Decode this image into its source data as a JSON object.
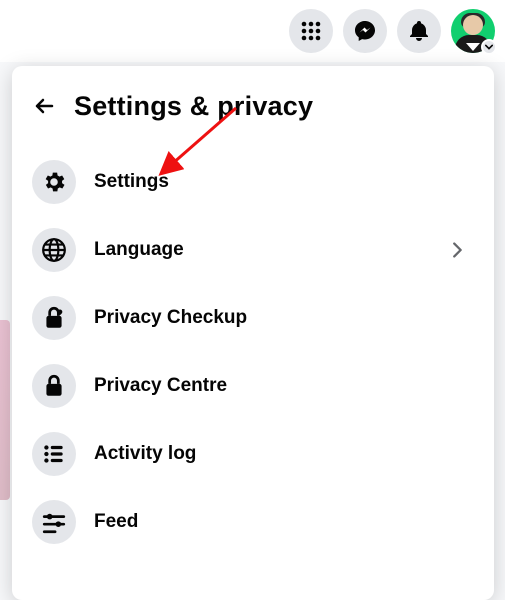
{
  "panel": {
    "title": "Settings & privacy",
    "items": [
      {
        "label": "Settings",
        "icon": "gear-icon",
        "chevron": false
      },
      {
        "label": "Language",
        "icon": "globe-icon",
        "chevron": true
      },
      {
        "label": "Privacy Checkup",
        "icon": "lock-heart-icon",
        "chevron": false
      },
      {
        "label": "Privacy Centre",
        "icon": "lock-icon",
        "chevron": false
      },
      {
        "label": "Activity log",
        "icon": "list-icon",
        "chevron": false
      },
      {
        "label": "Feed",
        "icon": "sliders-icon",
        "chevron": false
      }
    ]
  },
  "annotation": {
    "arrow_color": "#e11"
  }
}
